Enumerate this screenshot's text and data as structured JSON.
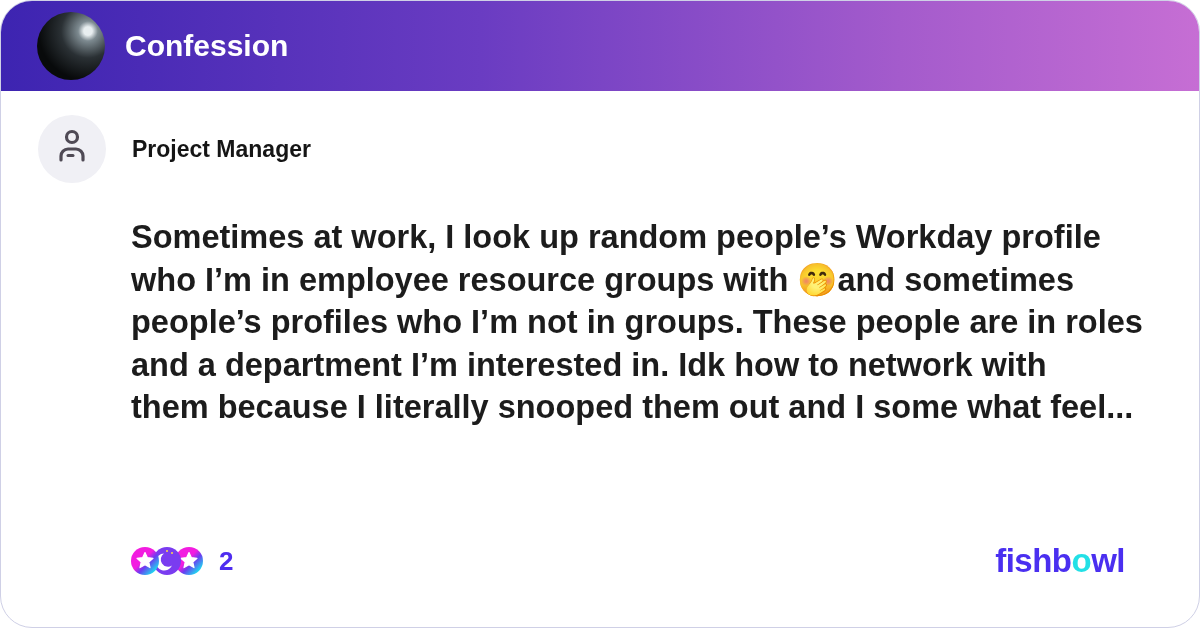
{
  "header": {
    "title": "Confession"
  },
  "author": {
    "name": "Project Manager"
  },
  "post": {
    "text": "Sometimes at work, I look up random people’s Workday profile\nwho I’m in employee resource groups with 🤭and sometimes\npeople’s profiles who I’m not in groups. These people are in roles\nand a department I’m interested in. Idk how to network with\nthem because I literally snooped them out and I some what feel..."
  },
  "footer": {
    "reactions": {
      "icons": [
        {
          "kind": "star"
        },
        {
          "kind": "moon"
        },
        {
          "kind": "star"
        }
      ],
      "count": "2"
    },
    "logo": {
      "parts": [
        {
          "text": "fishb",
          "color": "#4a2ff0"
        },
        {
          "text": "o",
          "color": "#22e0e6"
        },
        {
          "text": "wl",
          "color": "#4a2ff0"
        }
      ]
    }
  }
}
